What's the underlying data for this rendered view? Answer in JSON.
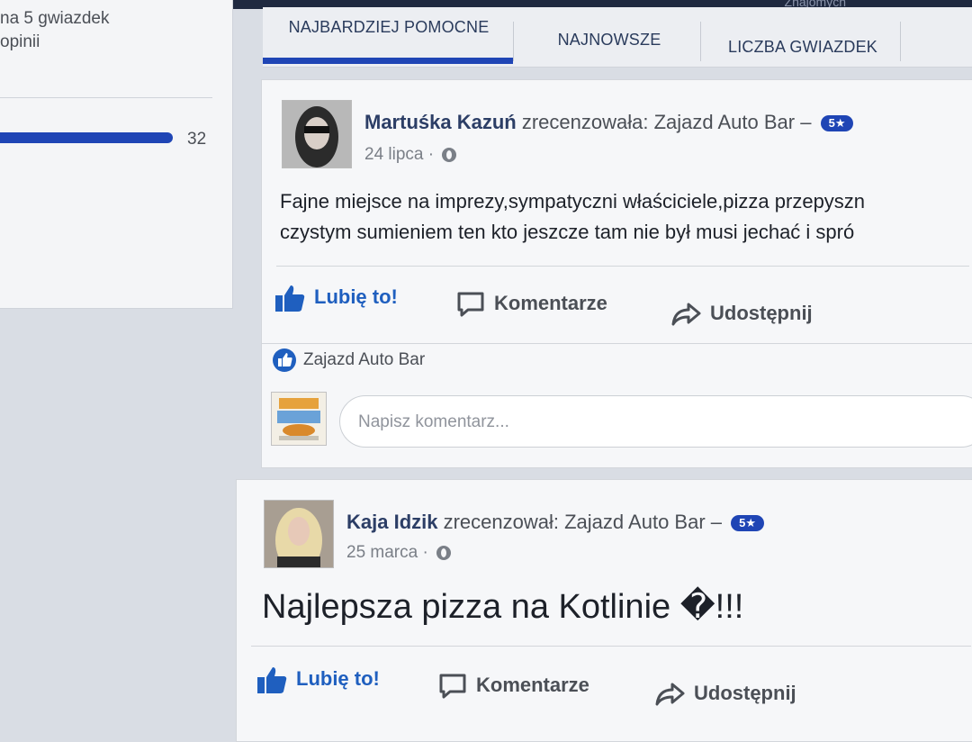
{
  "topbar": {
    "text": "Znajomych"
  },
  "sidebar": {
    "line1": "na 5 gwiazdek",
    "line2": "opinii",
    "rating_count": "32"
  },
  "tabs": [
    {
      "label": "NAJBARDZIEJ POMOCNE",
      "active": true
    },
    {
      "label": "NAJNOWSZE",
      "active": false
    },
    {
      "label": "LICZBA GWIAZDEK",
      "active": false
    }
  ],
  "reviews": [
    {
      "name": "Martuśka Kazuń",
      "action": "zrecenzowała: Zajazd Auto Bar –",
      "badge": "5★",
      "date": "24 lipca ·",
      "text_line1": "Fajne miejsce na imprezy,sympatyczni właściciele,pizza przepyszn",
      "text_line2": "czystym sumieniem ten kto jeszcze tam nie był musi jechać i spró"
    },
    {
      "name": "Kaja Idzik",
      "action": "zrecenzował: Zajazd Auto Bar –",
      "badge": "5★",
      "date": "25 marca ·",
      "text": "Najlepsza pizza na Kotlinie �!!!"
    }
  ],
  "actions": {
    "like": "Lubię to!",
    "comment": "Komentarze",
    "share": "Udostępnij"
  },
  "liked_by": "Zajazd Auto Bar",
  "comment_input": {
    "placeholder": "Napisz komentarz..."
  },
  "colors": {
    "accent": "#1f45b5",
    "link": "#1f5fbf"
  }
}
